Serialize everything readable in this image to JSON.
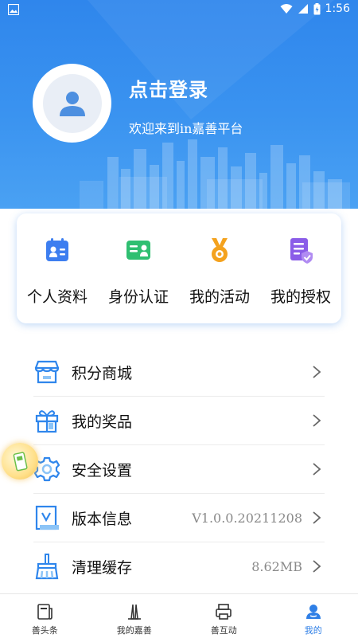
{
  "status_bar": {
    "time": "1:56"
  },
  "profile": {
    "login_text": "点击登录",
    "welcome_text": "欢迎来到in嘉善平台"
  },
  "quick_actions": [
    {
      "label": "个人资料",
      "icon": "profile-card-icon"
    },
    {
      "label": "身份认证",
      "icon": "id-card-icon"
    },
    {
      "label": "我的活动",
      "icon": "medal-icon"
    },
    {
      "label": "我的授权",
      "icon": "authorization-icon"
    }
  ],
  "menu": [
    {
      "label": "积分商城",
      "value": "",
      "icon": "store-icon"
    },
    {
      "label": "我的奖品",
      "value": "",
      "icon": "gift-icon"
    },
    {
      "label": "安全设置",
      "value": "",
      "icon": "gear-icon"
    },
    {
      "label": "版本信息",
      "value": "V1.0.0.20211208",
      "icon": "version-icon"
    },
    {
      "label": "清理缓存",
      "value": "8.62MB",
      "icon": "broom-icon"
    }
  ],
  "tabs": [
    {
      "label": "善头条",
      "icon": "news-icon",
      "active": false
    },
    {
      "label": "我的嘉善",
      "icon": "landmark-icon",
      "active": false
    },
    {
      "label": "善互动",
      "icon": "printer-icon",
      "active": false
    },
    {
      "label": "我的",
      "icon": "user-icon",
      "active": true
    }
  ],
  "colors": {
    "header_blue": "#2f86ec",
    "active_tab": "#2f7fe6",
    "card_shadow": "#468ce6"
  }
}
